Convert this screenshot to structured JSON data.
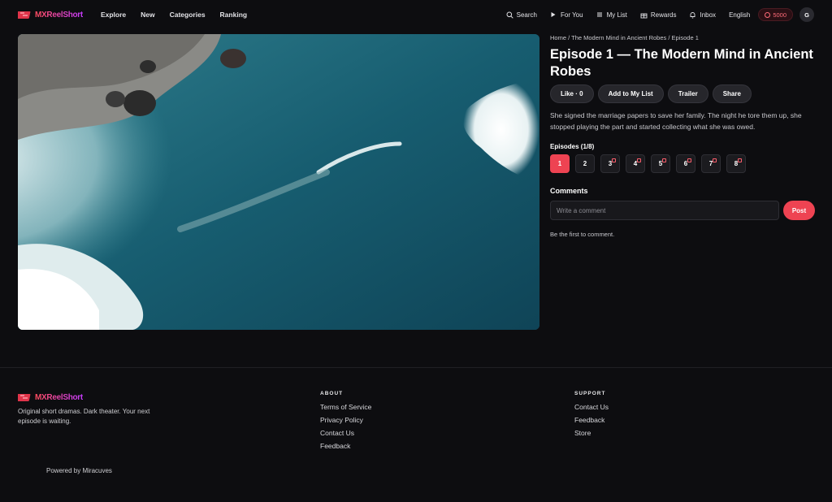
{
  "brand": {
    "name": "MXReelShort"
  },
  "nav": {
    "items": [
      "Explore",
      "New",
      "Categories",
      "Ranking"
    ]
  },
  "header_actions": {
    "search": "Search",
    "for_you": "For You",
    "my_list": "My List",
    "rewards": "Rewards",
    "inbox": "Inbox",
    "language": "English",
    "coins": "5000",
    "avatar_initial": "G"
  },
  "episode": {
    "breadcrumb": "Home / The Modern Mind in Ancient Robes / Episode 1",
    "title": "Episode 1 — The Modern Mind in Ancient Robes",
    "actions": {
      "like": "Like · 0",
      "add": "Add to My List",
      "trailer": "Trailer",
      "share": "Share"
    },
    "description": "She signed the marriage papers to save her family. The night he tore them up, she stopped playing the part and started collecting what she was owed.",
    "episodes_heading": "Episodes (1/8)",
    "episodes": [
      {
        "num": "1",
        "active": true,
        "locked": false
      },
      {
        "num": "2",
        "active": false,
        "locked": false
      },
      {
        "num": "3",
        "active": false,
        "locked": true
      },
      {
        "num": "4",
        "active": false,
        "locked": true
      },
      {
        "num": "5",
        "active": false,
        "locked": true
      },
      {
        "num": "6",
        "active": false,
        "locked": true
      },
      {
        "num": "7",
        "active": false,
        "locked": true
      },
      {
        "num": "8",
        "active": false,
        "locked": true
      }
    ]
  },
  "comments": {
    "heading": "Comments",
    "placeholder": "Write a comment",
    "post": "Post",
    "empty": "Be the first to comment."
  },
  "footer": {
    "tagline": "Original short dramas. Dark theater. Your next episode is waiting.",
    "about": {
      "heading": "ABOUT",
      "links": [
        "Terms of Service",
        "Privacy Policy",
        "Contact Us",
        "Feedback"
      ]
    },
    "support": {
      "heading": "SUPPORT",
      "links": [
        "Contact Us",
        "Feedback",
        "Store"
      ]
    },
    "powered": "Powered by Miracuves"
  },
  "colors": {
    "accent": "#ee4352",
    "background": "#0d0d10",
    "pill": "#26262b"
  }
}
